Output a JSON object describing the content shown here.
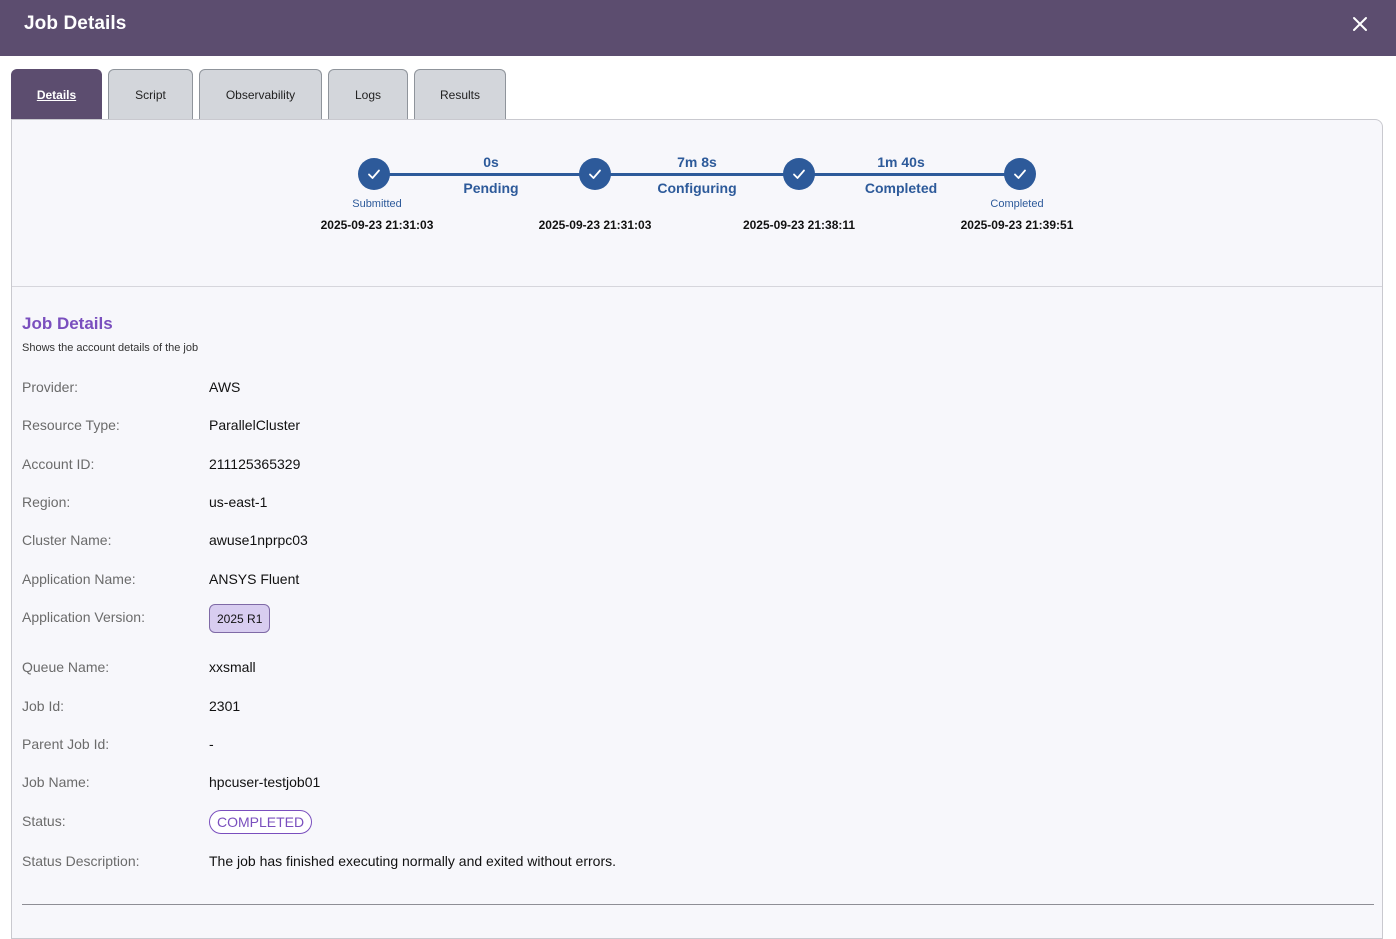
{
  "header": {
    "title": "Job Details"
  },
  "tabs": [
    {
      "label": "Details",
      "active": true
    },
    {
      "label": "Script",
      "active": false
    },
    {
      "label": "Observability",
      "active": false
    },
    {
      "label": "Logs",
      "active": false
    },
    {
      "label": "Results",
      "active": false
    }
  ],
  "timeline": {
    "steps": [
      {
        "label": "Submitted",
        "time": "2025-09-23 21:31:03"
      },
      {
        "label": "",
        "time": "2025-09-23 21:31:03"
      },
      {
        "label": "",
        "time": "2025-09-23 21:38:11"
      },
      {
        "label": "Completed",
        "time": "2025-09-23 21:39:51"
      }
    ],
    "phases": [
      {
        "duration": "0s",
        "name": "Pending"
      },
      {
        "duration": "7m 8s",
        "name": "Configuring"
      },
      {
        "duration": "1m 40s",
        "name": "Completed"
      }
    ],
    "color": "#2d5a9a"
  },
  "details": {
    "title": "Job Details",
    "subtitle": "Shows the account details of the job",
    "fields": {
      "provider": {
        "label": "Provider:",
        "value": "AWS"
      },
      "resource_type": {
        "label": "Resource Type:",
        "value": "ParallelCluster"
      },
      "account_id": {
        "label": "Account ID:",
        "value": "211125365329"
      },
      "region": {
        "label": "Region:",
        "value": "us-east-1"
      },
      "cluster_name": {
        "label": "Cluster Name:",
        "value": "awuse1nprpc03"
      },
      "application_name": {
        "label": "Application Name:",
        "value": "ANSYS Fluent"
      },
      "application_version": {
        "label": "Application Version:",
        "value": "2025 R1"
      },
      "queue_name": {
        "label": "Queue Name:",
        "value": "xxsmall"
      },
      "job_id": {
        "label": "Job Id:",
        "value": "2301"
      },
      "parent_job_id": {
        "label": "Parent Job Id:",
        "value": "-"
      },
      "job_name": {
        "label": "Job Name:",
        "value": "hpcuser-testjob01"
      },
      "status": {
        "label": "Status:",
        "value": "COMPLETED"
      },
      "status_description": {
        "label": "Status Description:",
        "value": "The job has finished executing normally and exited without errors."
      }
    }
  },
  "colors": {
    "header_bg": "#5c4d6f",
    "accent": "#7a4fbe",
    "timeline": "#2d5a9a"
  },
  "icons": {
    "close": "close-icon",
    "check": "check-icon"
  }
}
